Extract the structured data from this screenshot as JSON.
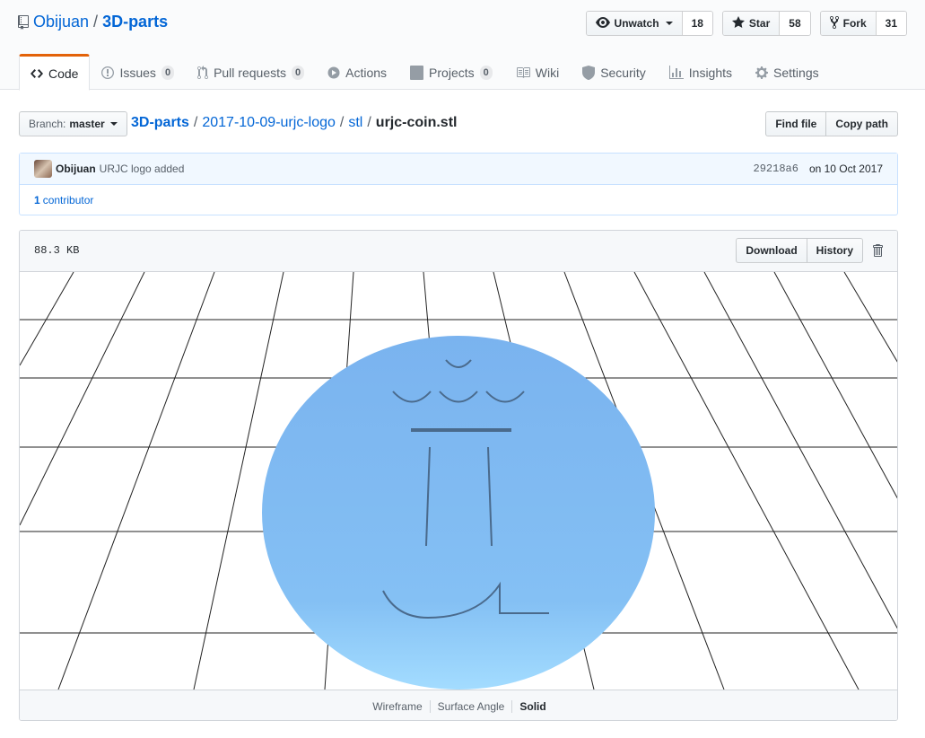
{
  "repo": {
    "owner": "Obijuan",
    "separator": "/",
    "name": "3D-parts"
  },
  "actions": [
    {
      "id": "watch",
      "label": "Unwatch",
      "count": "18"
    },
    {
      "id": "star",
      "label": "Star",
      "count": "58"
    },
    {
      "id": "fork",
      "label": "Fork",
      "count": "31"
    }
  ],
  "tabs": [
    {
      "label": "Code",
      "icon": "code-icon",
      "selected": true
    },
    {
      "label": "Issues",
      "icon": "issue-icon",
      "count": "0"
    },
    {
      "label": "Pull requests",
      "icon": "pull-request-icon",
      "count": "0"
    },
    {
      "label": "Actions",
      "icon": "play-icon"
    },
    {
      "label": "Projects",
      "icon": "project-icon",
      "count": "0"
    },
    {
      "label": "Wiki",
      "icon": "book-icon"
    },
    {
      "label": "Security",
      "icon": "shield-icon"
    },
    {
      "label": "Insights",
      "icon": "graph-icon"
    },
    {
      "label": "Settings",
      "icon": "gear-icon"
    }
  ],
  "branch": {
    "label": "Branch:",
    "value": "master"
  },
  "breadcrumb": {
    "repo": "3D-parts",
    "parts": [
      "2017-10-09-urjc-logo",
      "stl"
    ],
    "file": "urjc-coin.stl",
    "sep": "/"
  },
  "file_buttons": {
    "find": "Find file",
    "copy": "Copy path"
  },
  "commit": {
    "author": "Obijuan",
    "message": "URJC logo added",
    "sha": "29218a6",
    "date": "on 10 Oct 2017",
    "contributors_count": "1",
    "contributors_label": "contributor"
  },
  "file": {
    "size": "88.3 KB",
    "download": "Download",
    "history": "History"
  },
  "viewer_modes": [
    {
      "label": "Wireframe",
      "active": false
    },
    {
      "label": "Surface Angle",
      "active": false
    },
    {
      "label": "Solid",
      "active": true
    }
  ],
  "colors": {
    "accent": "#e36209",
    "link": "#0366d6",
    "coin_top": "#7ab3ef",
    "coin_bottom": "#a3dcff"
  }
}
